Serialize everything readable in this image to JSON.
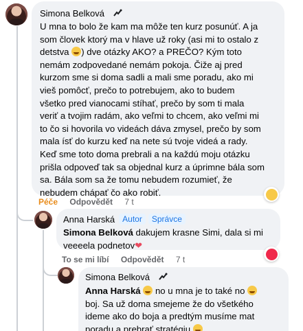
{
  "comments": [
    {
      "author": "Simona Belková",
      "lines": [
        "U mna to bolo že kam ma môže ten kurz posunúť. A ja",
        "som človek ktorý ma v hlave už roky (asi mi to ostalo z",
        "detstva ",
        ") dve otázky AKO? a PREČO? Kým toto",
        "nemám zodpovedané nemám pokoja. Čiže aj pred",
        "kurzom sme si doma sadli a mali sme poradu, ako mi",
        "vieš pomôcť, prečo to potrebujem, ako to budem",
        "všetko pred vianocami stíhať, prečo by som ti mala",
        "veriť a tvojim radám, ako veľmi to chcem, ako veľmi mi",
        "to čo si hovorila vo videách dáva zmysel, prečo by som",
        "mala ísť do kurzu keď na nete sú tvoje videá a rady.",
        "Keď sme toto doma prebrali a na každú moju otázku",
        "prišla odpoveď tak sa objednal kurz a úprimne bála som",
        "sa. Bála som sa že tomu nebudem rozumieť, že",
        "nebudem chápať čo ako robiť."
      ],
      "actions": {
        "like": "Péče",
        "reply": "Odpovědět",
        "time": "7 t"
      }
    },
    {
      "author": "Anna Harská",
      "badges": [
        "Autor",
        "Správce"
      ],
      "mention": "Simona Belková",
      "text_1": " dakujem krasne Simi, dala si mi",
      "text_2": "veeeela podnetov",
      "actions": {
        "like": "To se mi líbí",
        "reply": "Odpovědět",
        "time": "7 t"
      }
    },
    {
      "author": "Simona Belková",
      "mention": "Anna Harská",
      "text_1a": " no u mna je to také no ",
      "text_2": "boj. Sa už doma smejeme že do všetkého",
      "text_3": "ideme ako do boja a predtým musíme mat",
      "text_4": "poradu a prebrať stratégiu "
    }
  ],
  "colors": {
    "bubble": "#f0f2f5",
    "badge_text": "#1b74e4",
    "meta": "#65676b",
    "care": "#e88b1a"
  }
}
